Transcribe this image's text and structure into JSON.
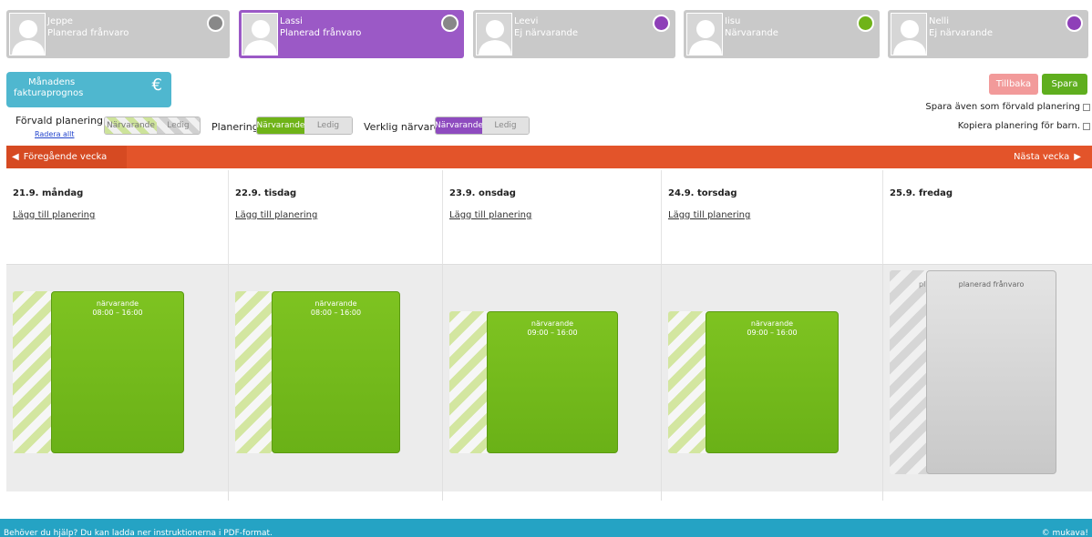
{
  "children": [
    {
      "name": "Jeppe",
      "status": "Planerad frånvaro",
      "dot_color": "#888888",
      "active": false
    },
    {
      "name": "Lassi",
      "status": "Planerad frånvaro",
      "dot_color": "#888888",
      "active": true
    },
    {
      "name": "Leevi",
      "status": "Ej närvarande",
      "dot_color": "#8e3fb8",
      "active": false
    },
    {
      "name": "Iisu",
      "status": "Närvarande",
      "dot_color": "#6fb318",
      "active": false
    },
    {
      "name": "Nelli",
      "status": "Ej närvarande",
      "dot_color": "#8e3fb8",
      "active": false
    }
  ],
  "forecast": {
    "line1": "Månadens",
    "line2": "fakturaprognos",
    "icon": "euro-icon",
    "symbol": "€"
  },
  "legend": {
    "default_label": "Förvald planering",
    "clear_all": "Radera allt",
    "default_on": "Närvarande",
    "default_off": "Ledig",
    "planning_label": "Planering",
    "planning_on": "Närvarande",
    "planning_off": "Ledig",
    "actual_label": "Verklig närvaro",
    "actual_on": "Närvarande",
    "actual_off": "Ledig"
  },
  "actions": {
    "back": "Tillbaka",
    "save": "Spara",
    "save_default": "Spara även som förvald planering",
    "copy_planning": "Kopiera planering för barn."
  },
  "week_nav": {
    "prev": "Föregående vecka",
    "next": "Nästa vecka"
  },
  "days": [
    {
      "title": "21.9. måndag",
      "add": "Lägg till planering",
      "label": "närvarande",
      "time": "08:00 – 16:00"
    },
    {
      "title": "22.9. tisdag",
      "add": "Lägg till planering",
      "label": "närvarande",
      "time": "08:00 – 16:00"
    },
    {
      "title": "23.9. onsdag",
      "add": "Lägg till planering",
      "label": "närvarande",
      "time": "09:00 – 16:00"
    },
    {
      "title": "24.9. torsdag",
      "add": "Lägg till planering",
      "label": "närvarande",
      "time": "09:00 – 16:00"
    },
    {
      "title": "25.9. fredag",
      "label": "planerad frånvaro",
      "stripe_text": "pl"
    }
  ],
  "footer": {
    "help": "Behöver du hjälp? Du kan ladda ner instruktionerna i PDF-format.",
    "copyright": "© mukava!"
  },
  "colors": {
    "accent_orange": "#e3542a",
    "present_green": "#6fb318",
    "purple": "#9b59c6",
    "teal": "#4fb7cf"
  }
}
